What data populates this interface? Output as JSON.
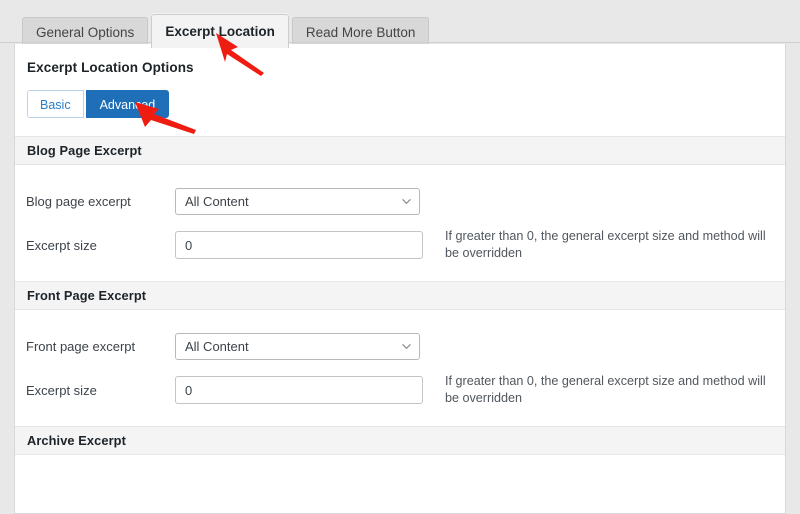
{
  "tabs": [
    {
      "label": "General Options",
      "active": false
    },
    {
      "label": "Excerpt Location",
      "active": true
    },
    {
      "label": "Read More Button",
      "active": false
    }
  ],
  "panel": {
    "title": "Excerpt Location Options",
    "mode_basic_label": "Basic",
    "mode_advanced_label": "Advanced",
    "active_mode": "Advanced"
  },
  "sections": [
    {
      "title": "Blog Page Excerpt",
      "fields": [
        {
          "label": "Blog page excerpt",
          "type": "select",
          "value": "All Content",
          "options": [
            "All Content"
          ],
          "help": ""
        },
        {
          "label": "Excerpt size",
          "type": "text",
          "value": "0",
          "placeholder": "",
          "help": "If greater than 0, the general excerpt size and method will be overridden"
        }
      ]
    },
    {
      "title": "Front Page Excerpt",
      "fields": [
        {
          "label": "Front page excerpt",
          "type": "select",
          "value": "All Content",
          "options": [
            "All Content"
          ],
          "help": ""
        },
        {
          "label": "Excerpt size",
          "type": "text",
          "value": "0",
          "placeholder": "",
          "help": "If greater than 0, the general excerpt size and method will be overridden"
        }
      ]
    },
    {
      "title": "Archive Excerpt",
      "fields": []
    }
  ],
  "annotations": [
    {
      "name": "arrow-pointing-to-excerpt-location-tab",
      "color": "#ee1c11"
    },
    {
      "name": "arrow-pointing-to-advanced-button",
      "color": "#ee1c11"
    }
  ],
  "colors": {
    "page_background": "#e8e8e8",
    "panel_background": "#ffffff",
    "section_header_background": "#f4f4f5",
    "primary_button": "#1f6fb8",
    "link_text": "#2a7fc9",
    "annotation_arrow": "#ee1c11"
  }
}
